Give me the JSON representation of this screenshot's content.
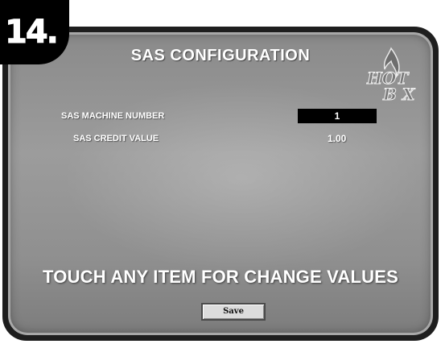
{
  "step_label": "14.",
  "screen": {
    "title": "SAS CONFIGURATION",
    "logo": {
      "text_line1": "HOT",
      "text_line2": "B X",
      "icon": "flame-icon"
    },
    "fields": [
      {
        "label": "SAS MACHINE NUMBER",
        "value": "1"
      },
      {
        "label": "SAS CREDIT VALUE",
        "value": "1.00"
      }
    ],
    "instruction": "TOUCH ANY ITEM FOR CHANGE VALUES",
    "save_label": "Save"
  },
  "colors": {
    "screen_bg": "#959595",
    "bezel": "#1e1e1e",
    "text": "#ffffff",
    "value_box": "#000000"
  }
}
